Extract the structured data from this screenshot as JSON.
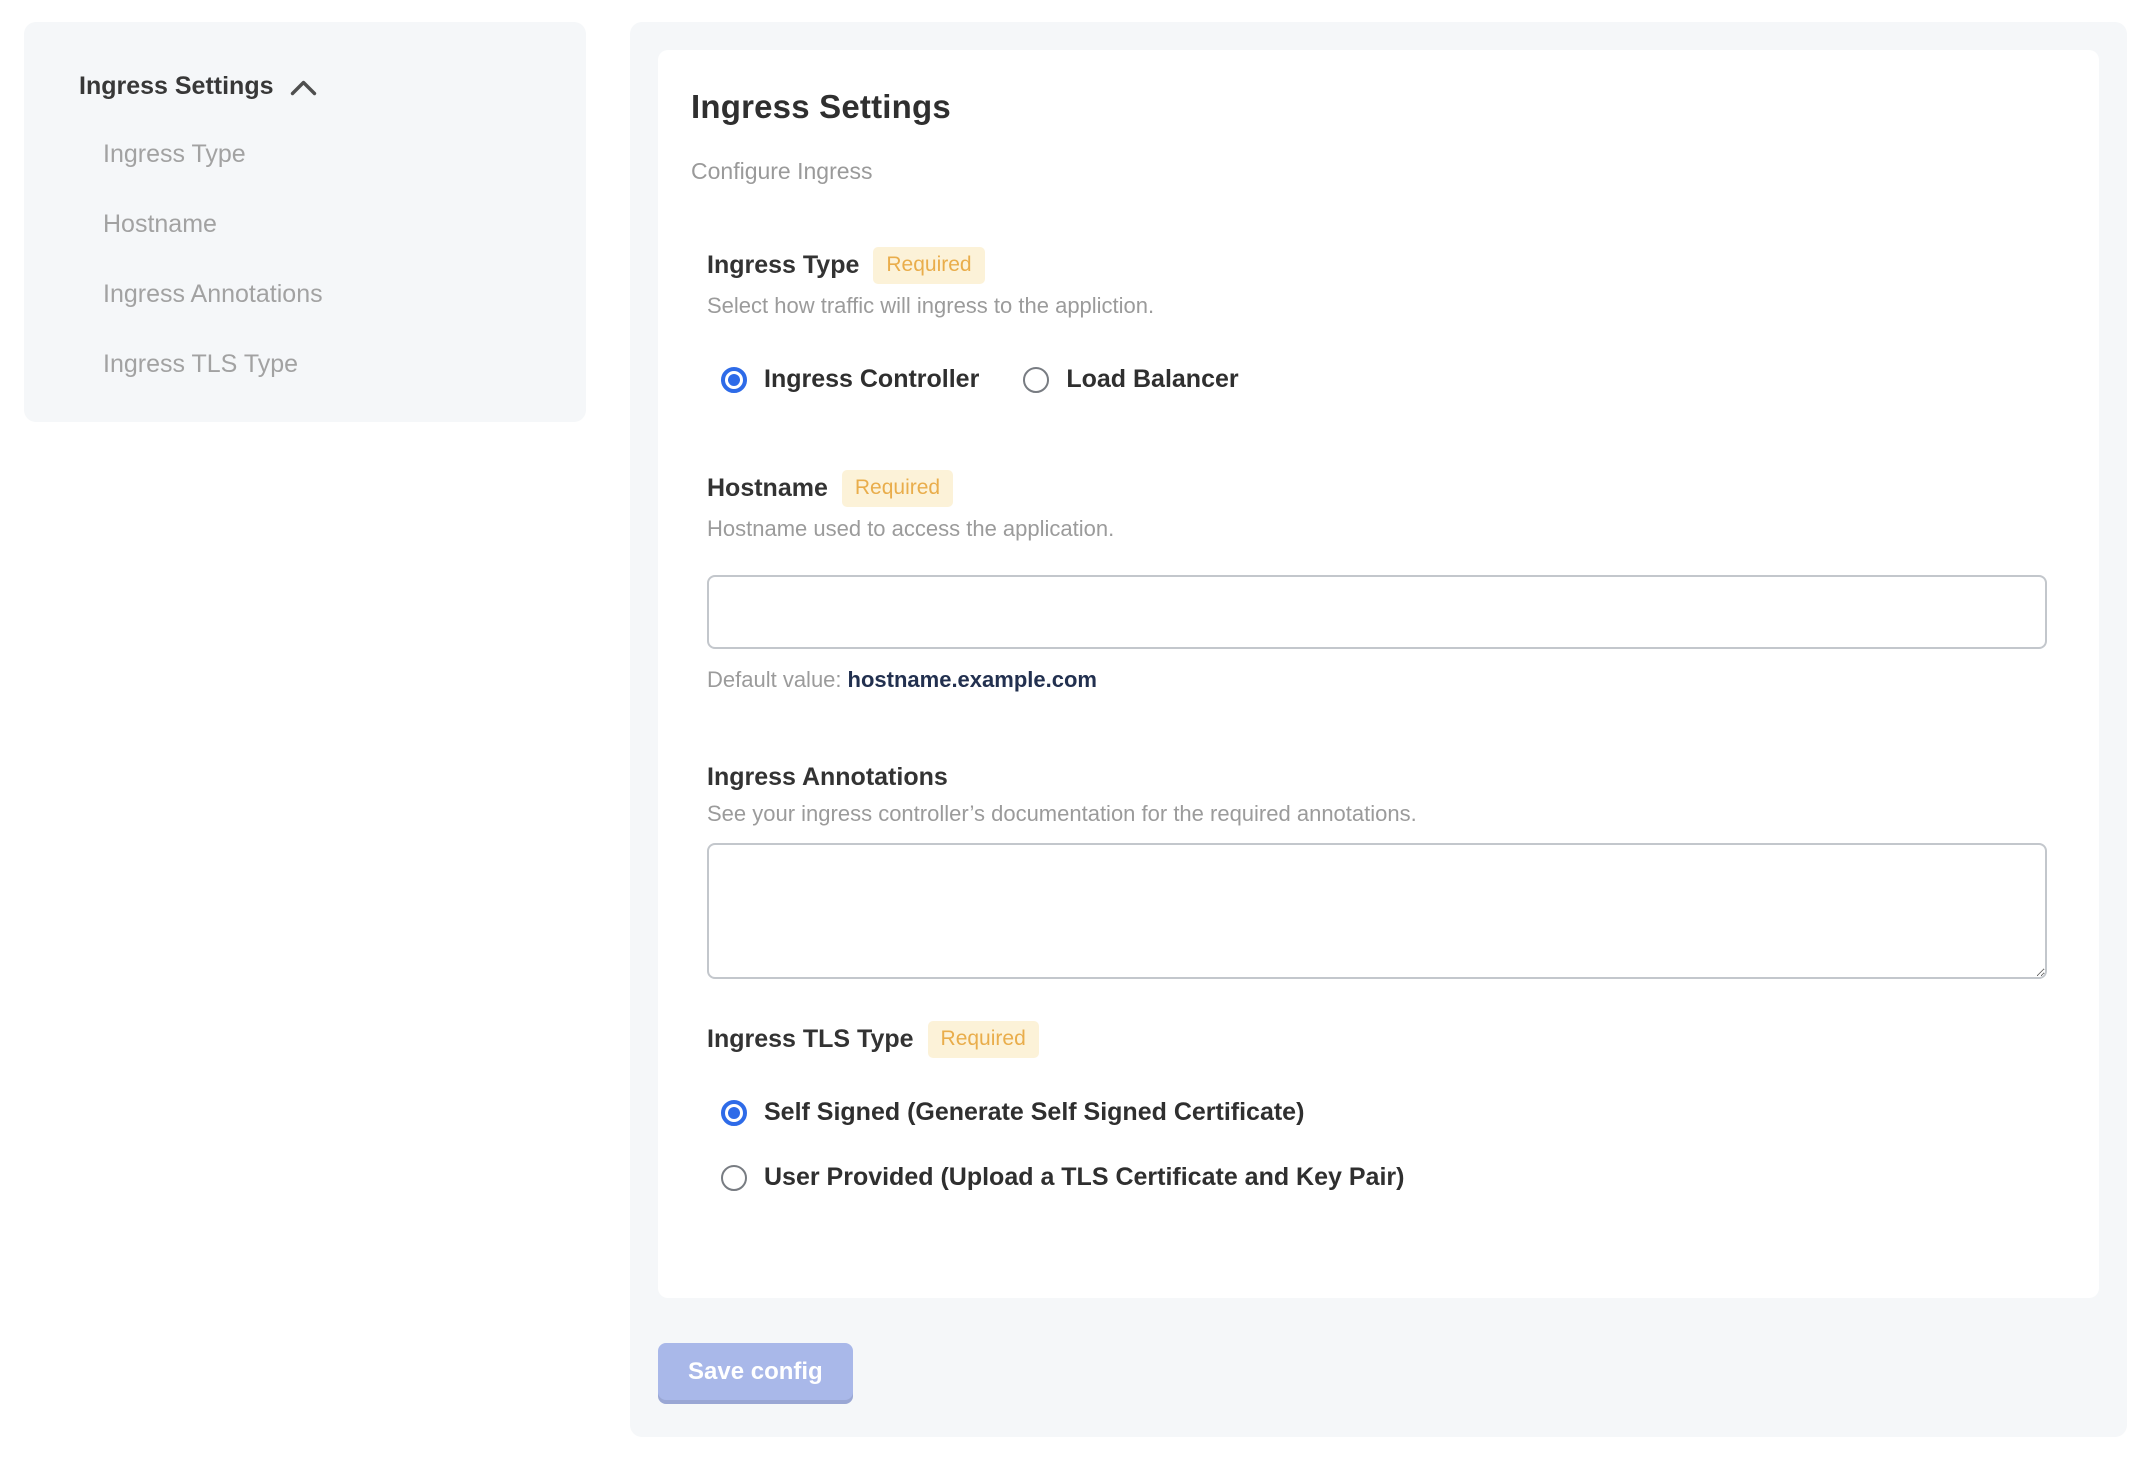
{
  "colors": {
    "panel_background": "#f5f7f9",
    "accent_blue": "#2e6be8",
    "badge_background": "#fcf2d8",
    "badge_text": "#e9ad4b",
    "default_value_navy": "#22304f",
    "save_button_background": "#a9b8e9",
    "muted_text": "#9b9b9b"
  },
  "sidebar": {
    "title": "Ingress Settings",
    "items": [
      {
        "label": "Ingress Type"
      },
      {
        "label": "Hostname"
      },
      {
        "label": "Ingress Annotations"
      },
      {
        "label": "Ingress TLS Type"
      }
    ]
  },
  "main": {
    "card": {
      "title": "Ingress Settings",
      "subtitle": "Configure Ingress",
      "required_badge": "Required",
      "sections": {
        "ingress_type": {
          "title": "Ingress Type",
          "help": "Select how traffic will ingress to the appliction.",
          "options": [
            {
              "label": "Ingress Controller",
              "selected": true
            },
            {
              "label": "Load Balancer",
              "selected": false
            }
          ]
        },
        "hostname": {
          "title": "Hostname",
          "help": "Hostname used to access the application.",
          "input_value": "",
          "default_label": "Default value:",
          "default_value": "hostname.example.com"
        },
        "annotations": {
          "title": "Ingress Annotations",
          "help": "See your ingress controller’s documentation for the required annotations.",
          "textarea_value": ""
        },
        "tls": {
          "title": "Ingress TLS Type",
          "options": [
            {
              "label": "Self Signed (Generate Self Signed Certificate)",
              "selected": true
            },
            {
              "label": "User Provided (Upload a TLS Certificate and Key Pair)",
              "selected": false
            }
          ]
        }
      }
    },
    "save_button_label": "Save config"
  }
}
